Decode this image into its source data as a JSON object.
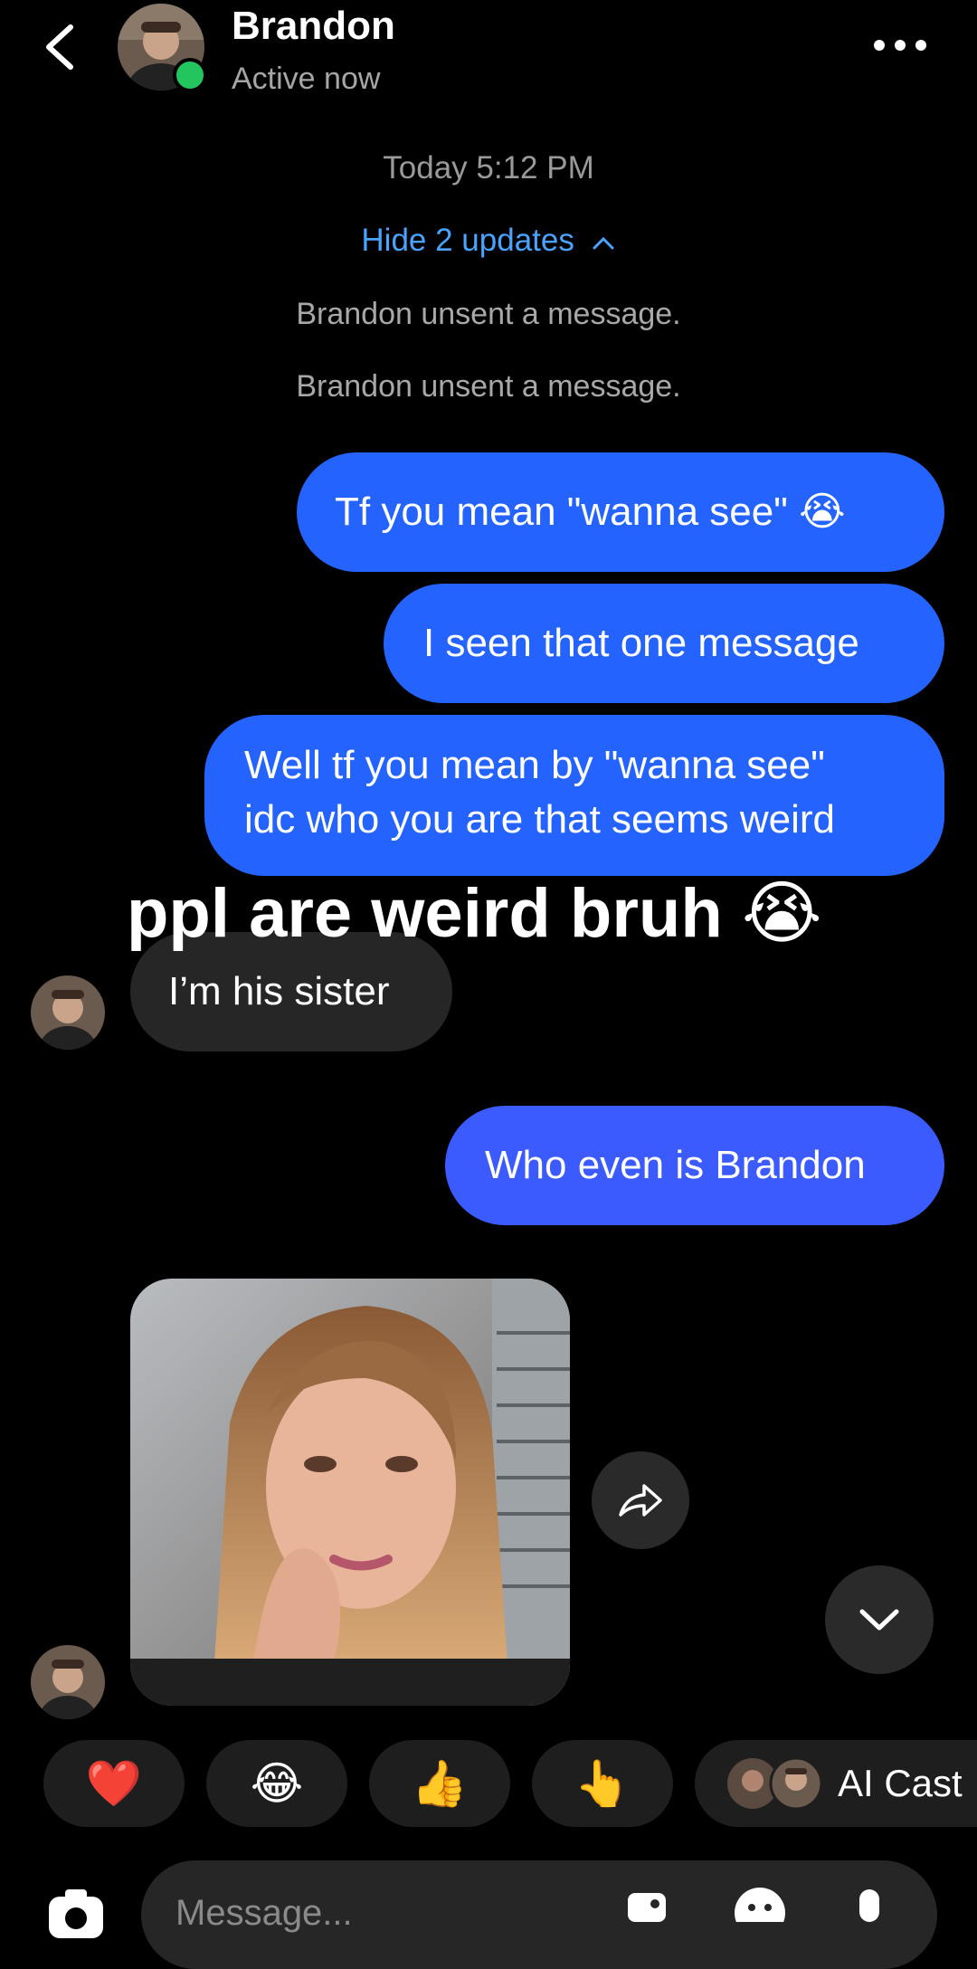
{
  "header": {
    "name": "Brandon",
    "status": "Active now"
  },
  "thread": {
    "timestamp": "Today 5:12 PM",
    "hide_updates": "Hide 2 updates",
    "unsent_1": "Brandon unsent a message.",
    "unsent_2": "Brandon unsent a message."
  },
  "messages": {
    "m1": "Tf you mean \"wanna see\" 😭",
    "m2": "I seen that one message",
    "m3_line1": "Well tf you mean by \"wanna see\"",
    "m3_line2": "idc who you are that seems weird",
    "r1": "I’m his sister",
    "m4": "Who even is Brandon"
  },
  "overlay_caption": "ppl are weird bruh 😭",
  "reactions": {
    "heart": "❤️",
    "laugh": "😂",
    "thumbs_up": "👍",
    "point": "👆",
    "ai_cast_label": "AI Cast"
  },
  "composer": {
    "placeholder": "Message..."
  },
  "colors": {
    "sent_bubble": "#2563ff",
    "received_bubble": "#262626",
    "link_blue": "#4aa3ff",
    "online_green": "#22c55e"
  },
  "icons": [
    "back-arrow-icon",
    "more-options-icon",
    "chevron-up-icon",
    "share-icon",
    "chevron-down-icon",
    "camera-icon",
    "gallery-icon",
    "sticker-icon",
    "microphone-icon"
  ]
}
